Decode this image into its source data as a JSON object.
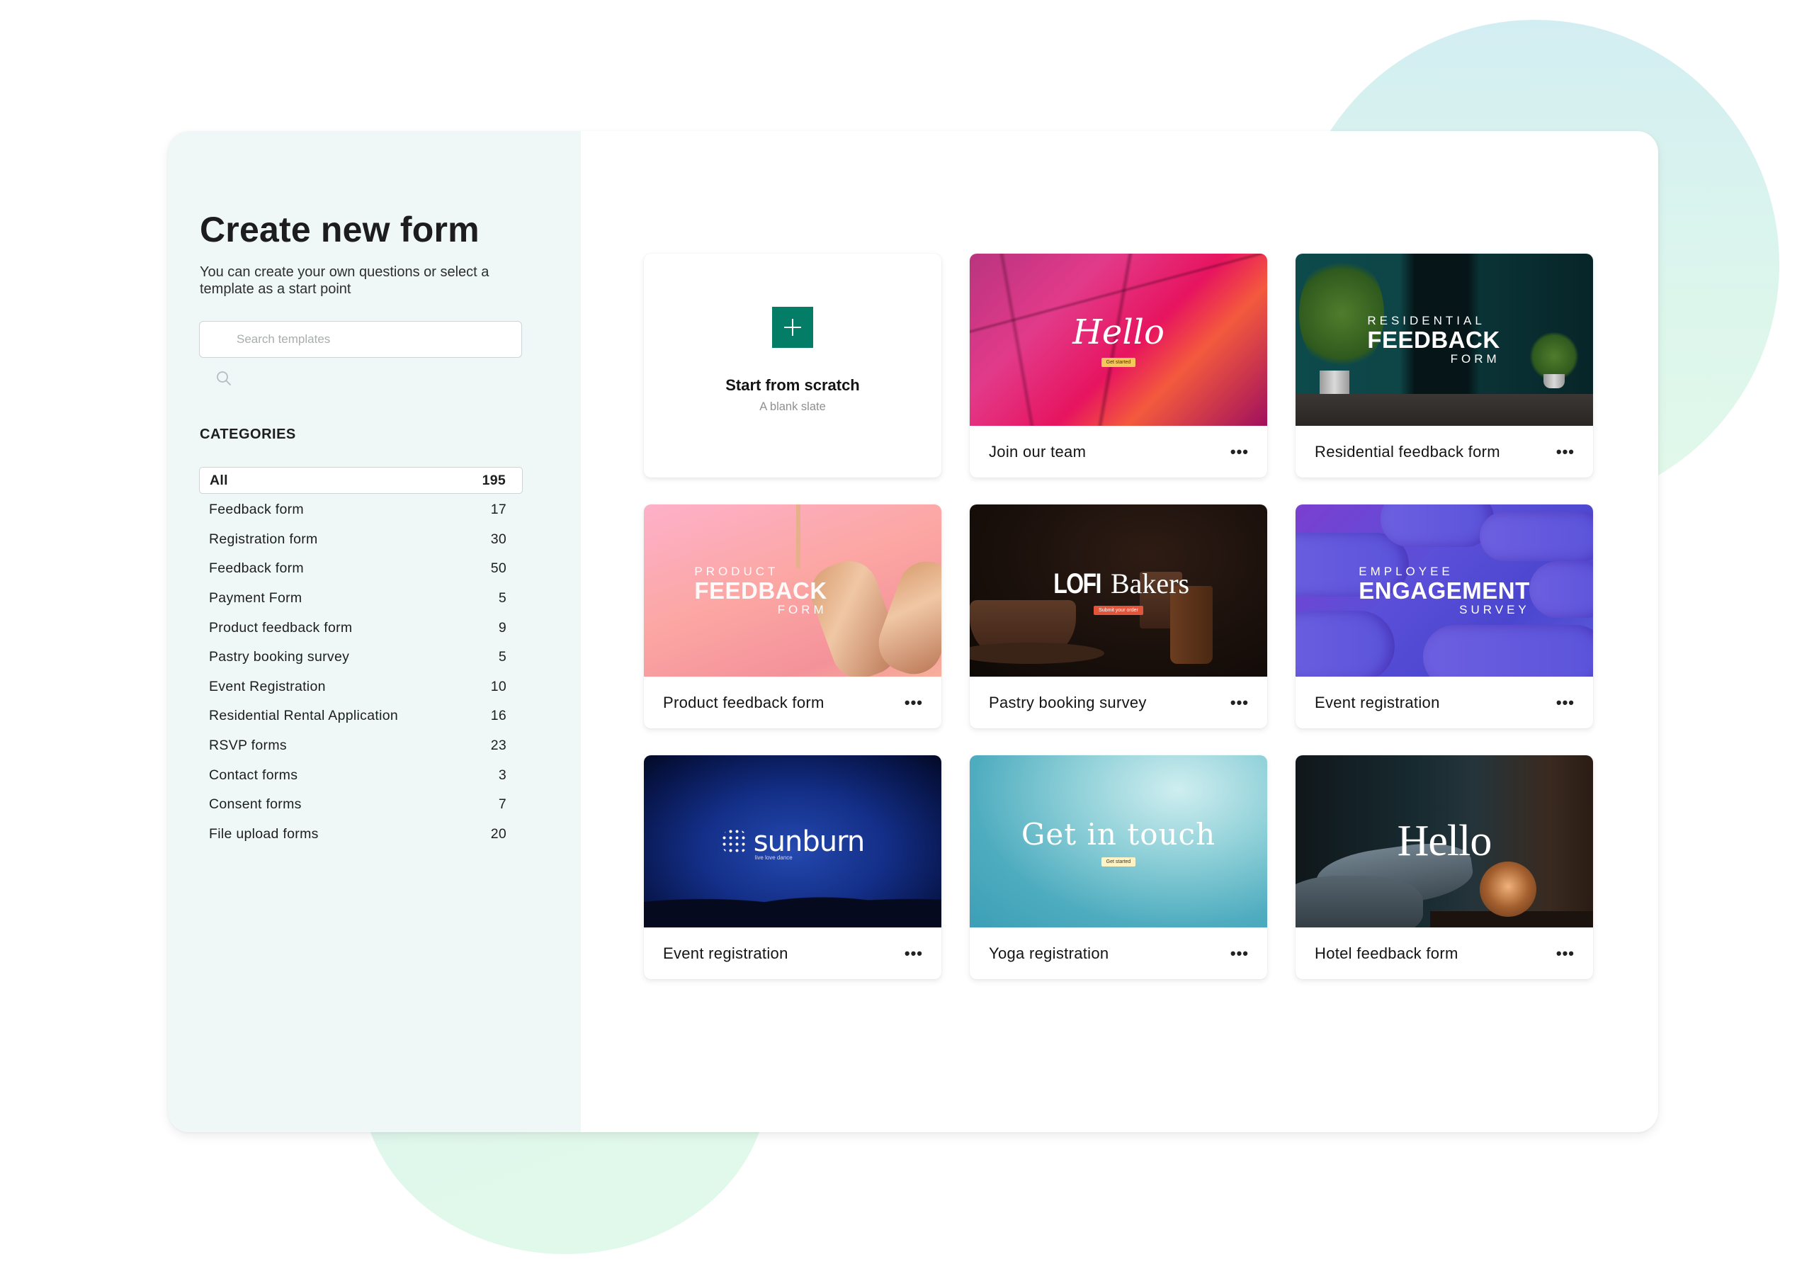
{
  "sidebar": {
    "title": "Create new form",
    "subtitle": "You can create your own questions or select a template as a start point",
    "search": {
      "placeholder": "Search templates",
      "value": ""
    },
    "categories_heading": "CATEGORIES",
    "categories": [
      {
        "label": "All",
        "count": "195",
        "selected": true
      },
      {
        "label": "Feedback form",
        "count": "17"
      },
      {
        "label": "Registration form",
        "count": "30"
      },
      {
        "label": "Feedback form",
        "count": "50"
      },
      {
        "label": "Payment Form",
        "count": "5"
      },
      {
        "label": "Product feedback form",
        "count": "9"
      },
      {
        "label": "Pastry booking survey",
        "count": "5"
      },
      {
        "label": "Event Registration",
        "count": "10"
      },
      {
        "label": "Residential Rental Application",
        "count": "16"
      },
      {
        "label": "RSVP forms",
        "count": "23"
      },
      {
        "label": "Contact forms",
        "count": "3"
      },
      {
        "label": "Consent forms",
        "count": "7"
      },
      {
        "label": "File upload forms",
        "count": "20"
      }
    ]
  },
  "scratch_card": {
    "title": "Start from scratch",
    "subtitle": "A blank slate",
    "icon": "plus-icon",
    "accent": "#047d66"
  },
  "templates": [
    {
      "title": "Join our team",
      "art": {
        "headline": "Hello",
        "button": "Get started",
        "button_color": "#f6c85a"
      }
    },
    {
      "title": "Residential feedback form",
      "art": {
        "top": "RESIDENTIAL",
        "main": "FEEDBACK",
        "bottom": "FORM"
      }
    },
    {
      "title": "Product feedback form",
      "art": {
        "top": "PRODUCT",
        "main": "FEEDBACK",
        "bottom": "FORM"
      }
    },
    {
      "title": "Pastry booking survey",
      "art": {
        "brand_bold": "LOFI",
        "brand_serif": "Bakers",
        "button": "Submit your order",
        "button_color": "#e2553b"
      }
    },
    {
      "title": "Event registration",
      "art": {
        "top": "EMPLOYEE",
        "main": "ENGAGEMENT",
        "bottom": "SURVEY"
      }
    },
    {
      "title": "Event registration",
      "art": {
        "brand": "sunburn",
        "tagline": "live love dance"
      }
    },
    {
      "title": "Yoga registration",
      "art": {
        "headline": "Get in touch",
        "button": "Get started",
        "button_color": "#fdf3c4"
      }
    },
    {
      "title": "Hotel feedback form",
      "art": {
        "headline": "Hello"
      }
    }
  ],
  "more_label": "•••"
}
